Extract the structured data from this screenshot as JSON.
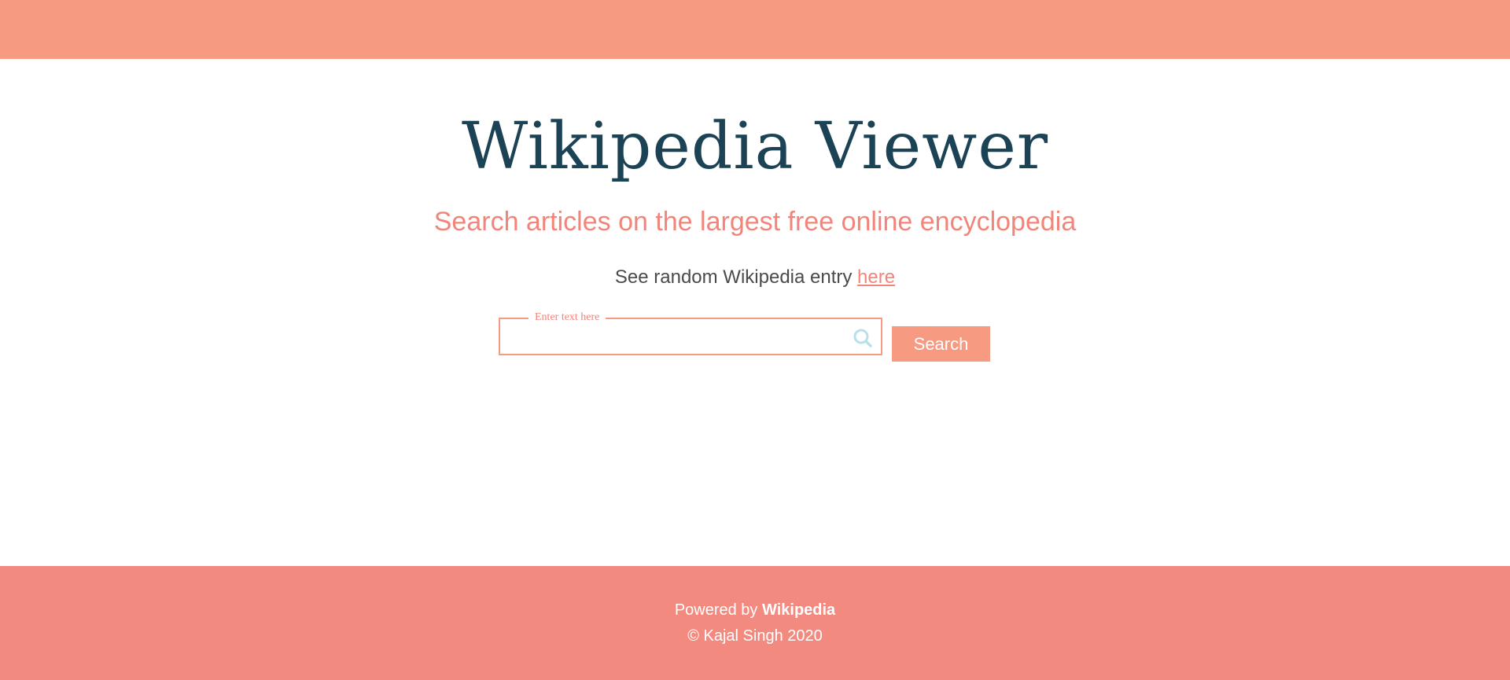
{
  "header": {
    "bar_color": "#f69a82"
  },
  "main": {
    "title": "Wikipedia Viewer",
    "subtitle": "Search articles on the largest free online encyclopedia",
    "random_text": "See random Wikipedia entry",
    "random_link_label": "here"
  },
  "search": {
    "legend": "Enter text here",
    "value": "",
    "icon": "search-icon",
    "button_label": "Search"
  },
  "footer": {
    "powered_prefix": "Powered by",
    "powered_link": "Wikipedia",
    "copyright": "© Kajal Singh 2020"
  },
  "colors": {
    "accent": "#f69a82",
    "title": "#1c4255",
    "footer": "#f38a80",
    "icon": "#b8e0e8"
  }
}
